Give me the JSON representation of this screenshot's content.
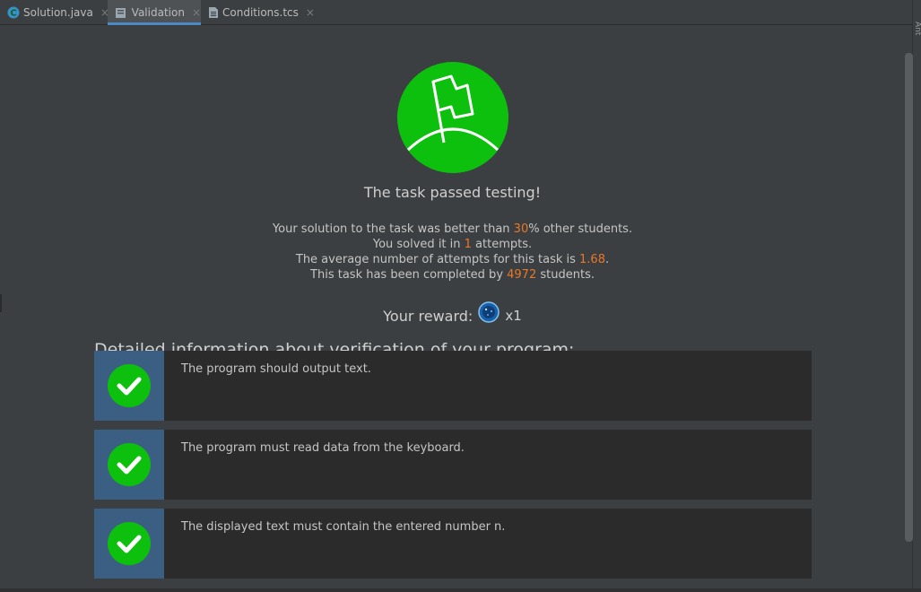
{
  "tabs": [
    {
      "label": "Solution.java",
      "icon": "java-class-icon",
      "active": false
    },
    {
      "label": "Validation",
      "icon": "validation-icon",
      "active": true
    },
    {
      "label": "Conditions.tcs",
      "icon": "document-icon",
      "active": false
    }
  ],
  "tab_close_glyph": "×",
  "right_strip_label": "Ant",
  "result": {
    "title": "The task passed testing!",
    "line1": {
      "pre": "Your solution to the task was better than ",
      "value": "30",
      "post": "% other students."
    },
    "line2": {
      "pre": "You solved it in ",
      "value": "1",
      "post": " attempts."
    },
    "line3": {
      "pre": "The average number of attempts for this task is ",
      "value": "1.68",
      "post": "."
    },
    "line4": {
      "pre": "This task has been completed by ",
      "value": "4972",
      "post": " students."
    },
    "reward_label": "Your reward:",
    "reward_multiplier": "x1"
  },
  "details": {
    "heading": "Detailed information about verification of your program:",
    "checks": [
      {
        "text": "The program should output text.",
        "passed": true
      },
      {
        "text": "The program must read data from the keyboard.",
        "passed": true
      },
      {
        "text": "The displayed text must contain the entered number n.",
        "passed": true
      }
    ]
  },
  "colors": {
    "success_green": "#0ec00e",
    "highlight_orange": "#e8782a",
    "accent_blue": "#4a88c7",
    "check_side_blue": "#3b5f82"
  }
}
